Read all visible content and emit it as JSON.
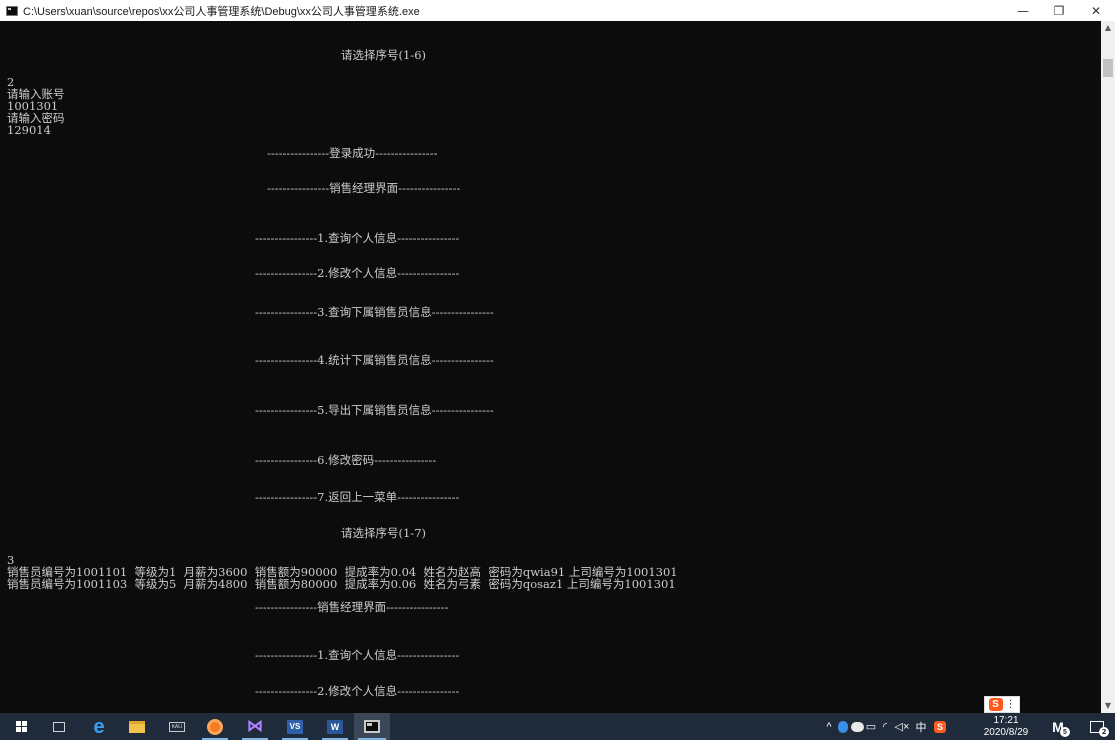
{
  "window": {
    "title": "C:\\Users\\xuan\\source\\repos\\xx公司人事管理系统\\Debug\\xx公司人事管理系统.exe",
    "minimize_glyph": "—",
    "maximize_glyph": "❐",
    "close_glyph": "✕"
  },
  "console_lines": [
    {
      "id": "menu-prompt-1-6",
      "text": "请选择序号(1-6)"
    },
    {
      "id": "input-choice-2",
      "text": "2"
    },
    {
      "id": "prompt-account",
      "text": "请输入账号"
    },
    {
      "id": "input-account",
      "text": "1001301"
    },
    {
      "id": "prompt-password",
      "text": "请输入密码"
    },
    {
      "id": "input-password",
      "text": "129014"
    },
    {
      "id": "login-success",
      "text": "----------------登录成功----------------"
    },
    {
      "id": "sales-manager-title",
      "text": "----------------销售经理界面----------------"
    },
    {
      "id": "menu-1",
      "text": "----------------1.查询个人信息----------------"
    },
    {
      "id": "menu-2",
      "text": "----------------2.修改个人信息----------------"
    },
    {
      "id": "menu-3",
      "text": "----------------3.查询下属销售员信息----------------"
    },
    {
      "id": "menu-4",
      "text": "----------------4.统计下属销售员信息----------------"
    },
    {
      "id": "menu-5",
      "text": "----------------5.导出下属销售员信息----------------"
    },
    {
      "id": "menu-6",
      "text": "----------------6.修改密码----------------"
    },
    {
      "id": "menu-7",
      "text": "----------------7.返回上一菜单----------------"
    },
    {
      "id": "menu-prompt-1-7",
      "text": "请选择序号(1-7)"
    },
    {
      "id": "input-choice-3",
      "text": "3"
    },
    {
      "id": "record-1",
      "text": "销售员编号为1001101  等级为1  月薪为3600  销售额为90000  提成率为0.04  姓名为赵高  密码为qwia91 上司编号为1001301"
    },
    {
      "id": "record-2",
      "text": "销售员编号为1001103  等级为5  月薪为4800  销售额为80000  提成率为0.06  姓名为弓素  密码为qosaz1 上司编号为1001301"
    },
    {
      "id": "sales-manager-title-2",
      "text": "----------------销售经理界面----------------"
    },
    {
      "id": "menu-1-repeat",
      "text": "----------------1.查询个人信息----------------"
    },
    {
      "id": "menu-2-repeat",
      "text": "----------------2.修改个人信息----------------"
    }
  ],
  "scrollbar": {
    "up": "▲",
    "down": "▼"
  },
  "ime": {
    "logo": "S",
    "menu": "⋮"
  },
  "taskbar": {
    "items": [
      {
        "name": "start-button-icon"
      },
      {
        "name": "task-view-icon"
      },
      {
        "name": "edge-browser-icon",
        "glyph": "e"
      },
      {
        "name": "file-explorer-icon"
      },
      {
        "name": "keyboard-app-icon",
        "label": "KALI"
      },
      {
        "name": "orange-app-icon"
      },
      {
        "name": "visual-studio-icon",
        "glyph": "⋈"
      },
      {
        "name": "visual-studio-box-icon",
        "label": "VS"
      },
      {
        "name": "word-icon",
        "label": "W"
      },
      {
        "name": "console-app-icon"
      }
    ],
    "tray": {
      "chevron": "^",
      "network": "◜",
      "volume": "◁×",
      "language": "中",
      "ime": "S"
    },
    "clock": {
      "time": "17:21",
      "date": "2020/8/29"
    },
    "m_label": "M",
    "m_badge": "5",
    "notif_badge": "2"
  },
  "colors": {
    "console_bg": "#0c0c0c",
    "console_text": "#cccccc",
    "taskbar_bg": "#1f2a3a",
    "titlebar_bg": "#ffffff"
  }
}
